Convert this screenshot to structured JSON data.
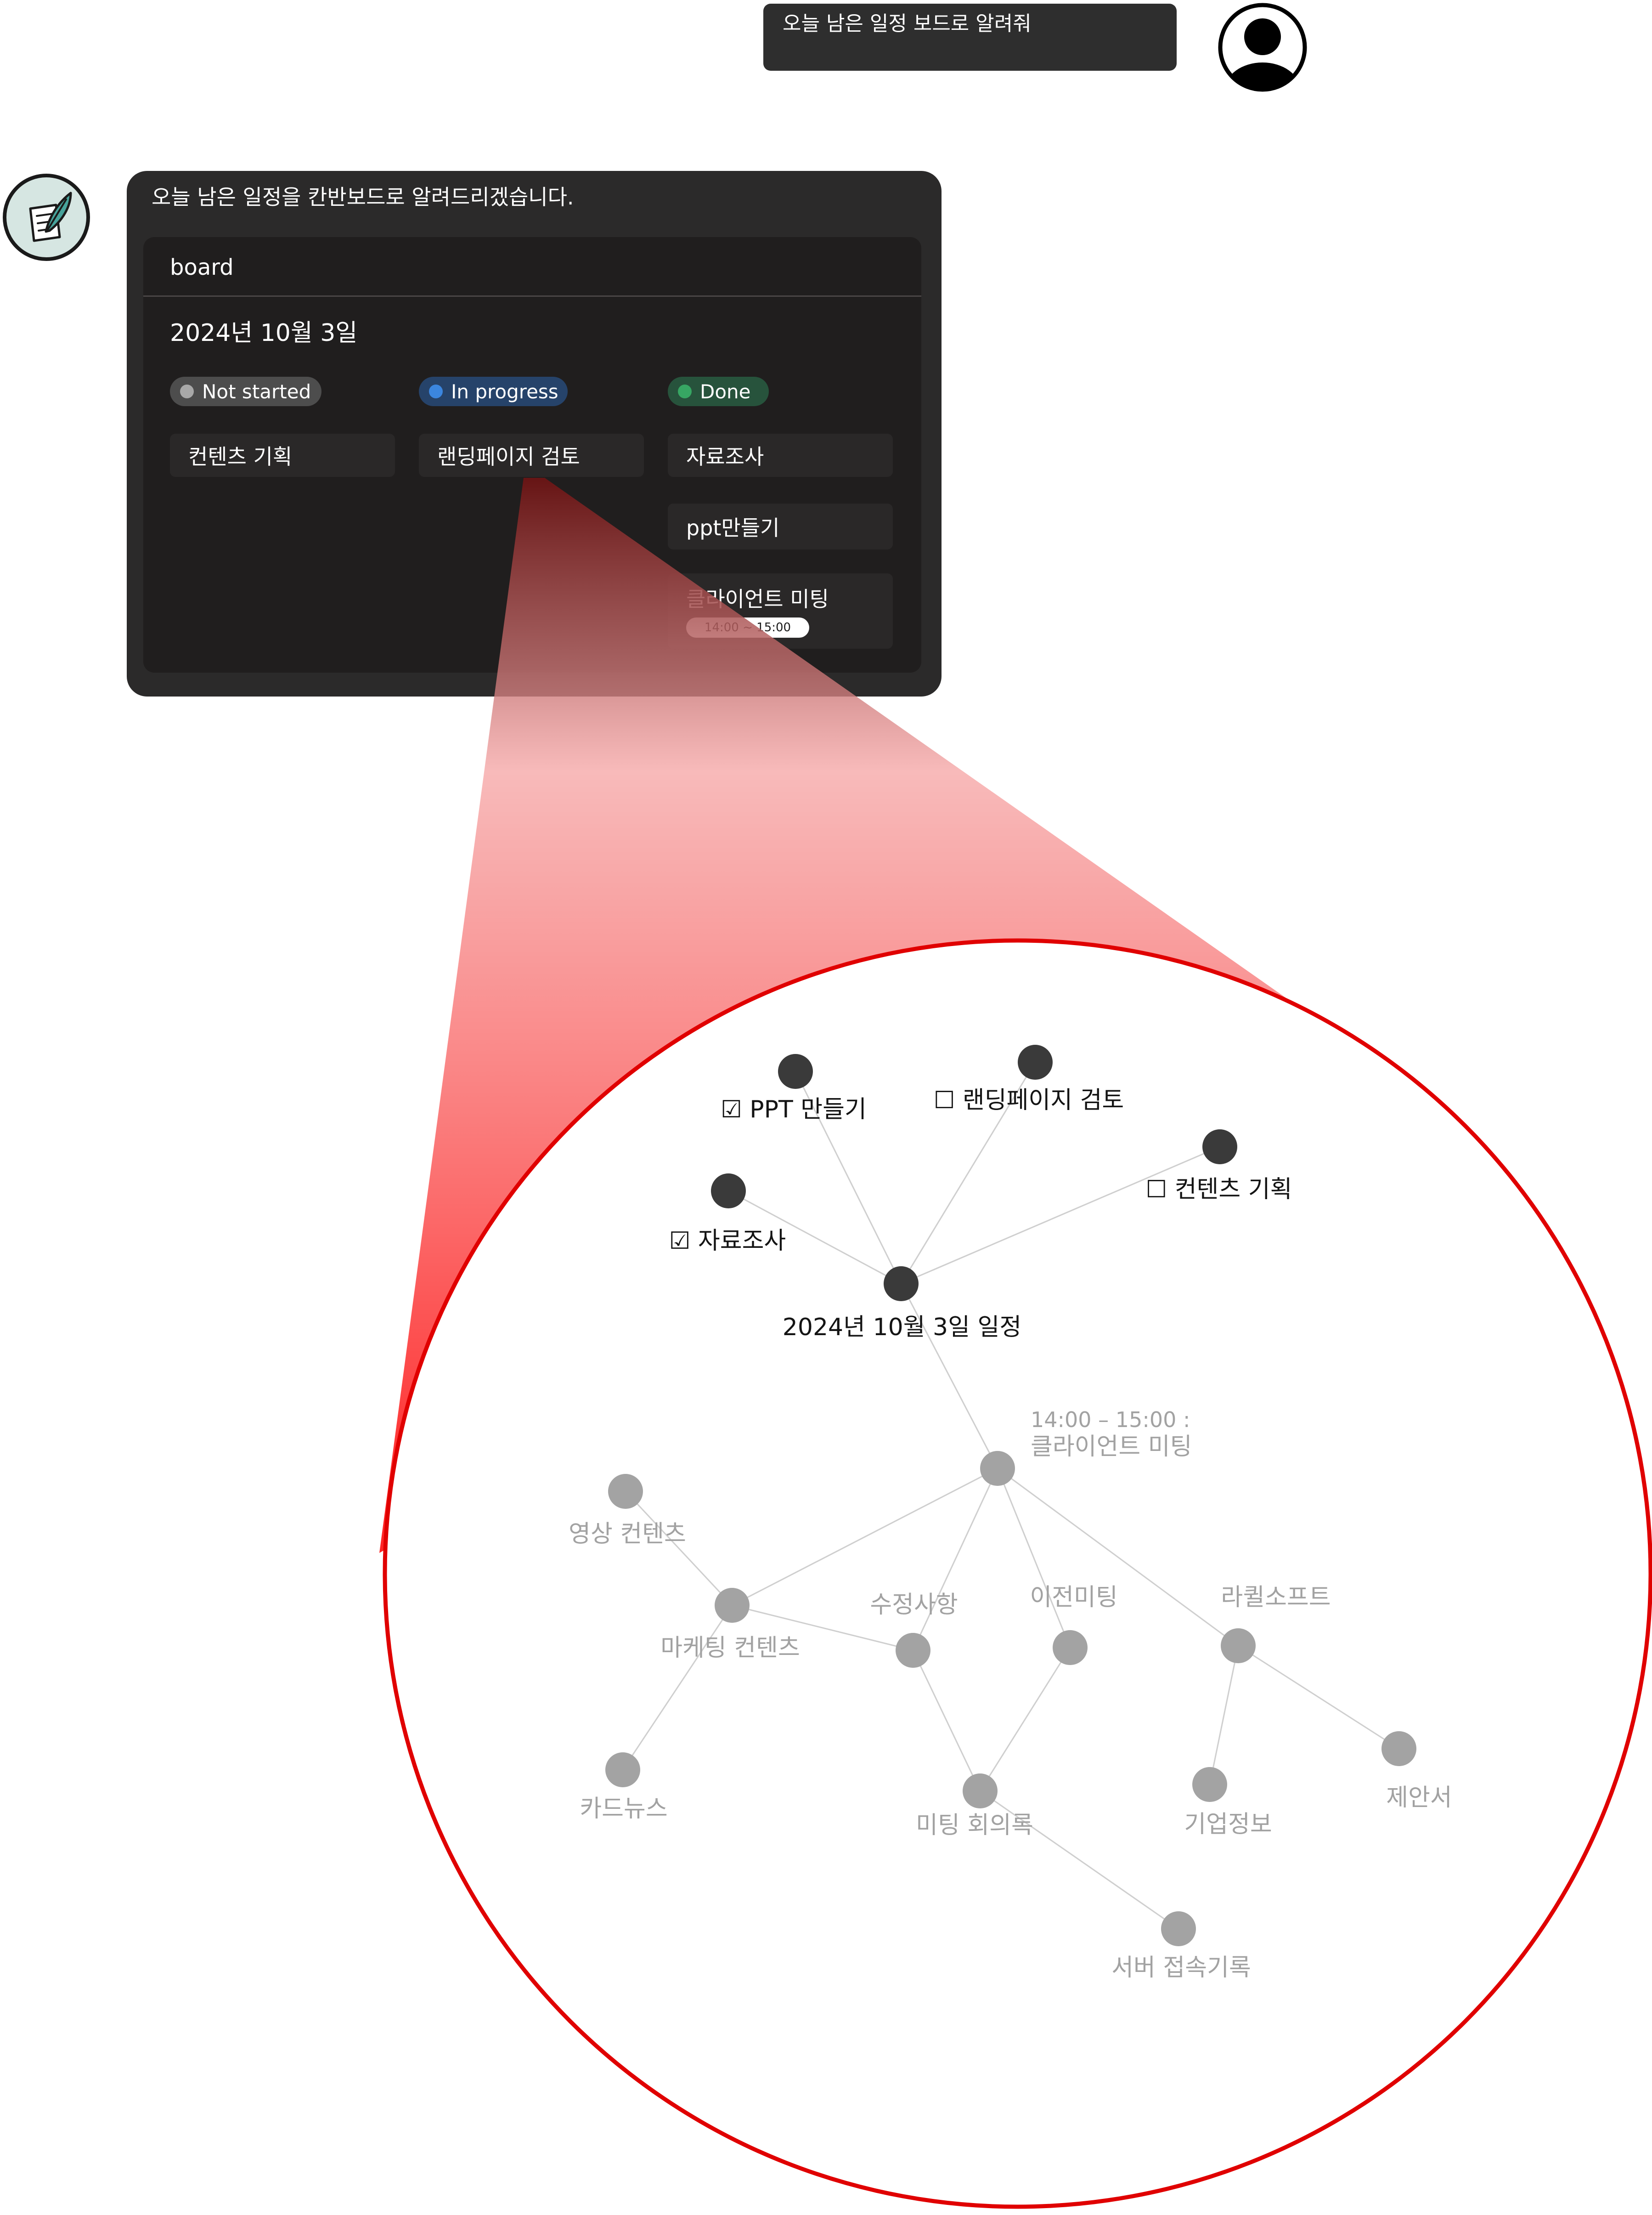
{
  "user_message": "오늘 남은 일정 보드로 알려줘",
  "assistant": {
    "message": "오늘 남은 일정을 칸반보드로 알려드리겠습니다.",
    "board": {
      "title": "board",
      "date": "2024년 10월 3일",
      "columns": [
        {
          "status": "Not started",
          "color": "#a8a8a8",
          "tasks": [
            "컨텐츠 기획"
          ]
        },
        {
          "status": "In progress",
          "color": "#3b86df",
          "tasks": [
            "랜딩페이지 검토"
          ]
        },
        {
          "status": "Done",
          "color": "#37a663",
          "tasks": [
            "자료조사",
            "ppt만들기",
            "클라이언트 미팅"
          ]
        }
      ],
      "client_meeting_time": "14:00 ~ 15:00"
    }
  },
  "graph": {
    "nodes": {
      "ppt": "☑ PPT 만들기",
      "landing": "☐ 랜딩페이지 검토",
      "content_plan": "☐ 컨텐츠 기획",
      "research": "☑ 자료조사",
      "schedule": "2024년 10월 3일 일정",
      "client_time": "14:00 – 15:00 :",
      "client_meeting": "클라이언트 미팅",
      "video_content": "영상 컨텐츠",
      "marketing_content": "마케팅 컨텐츠",
      "revisions": "수정사항",
      "previous_meeting": "이전미팅",
      "lacuil_soft": "라퀼소프트",
      "card_news": "카드뉴스",
      "meeting_minutes": "미팅 회의록",
      "company_info": "기업정보",
      "proposal": "제안서",
      "server_log": "서버 접속기록"
    }
  },
  "colors": {
    "zoom_highlight": "#e00000",
    "active_node": "#3a3a3a",
    "inactive_node": "#a3a3a3",
    "edge": "#cfcfcf"
  }
}
